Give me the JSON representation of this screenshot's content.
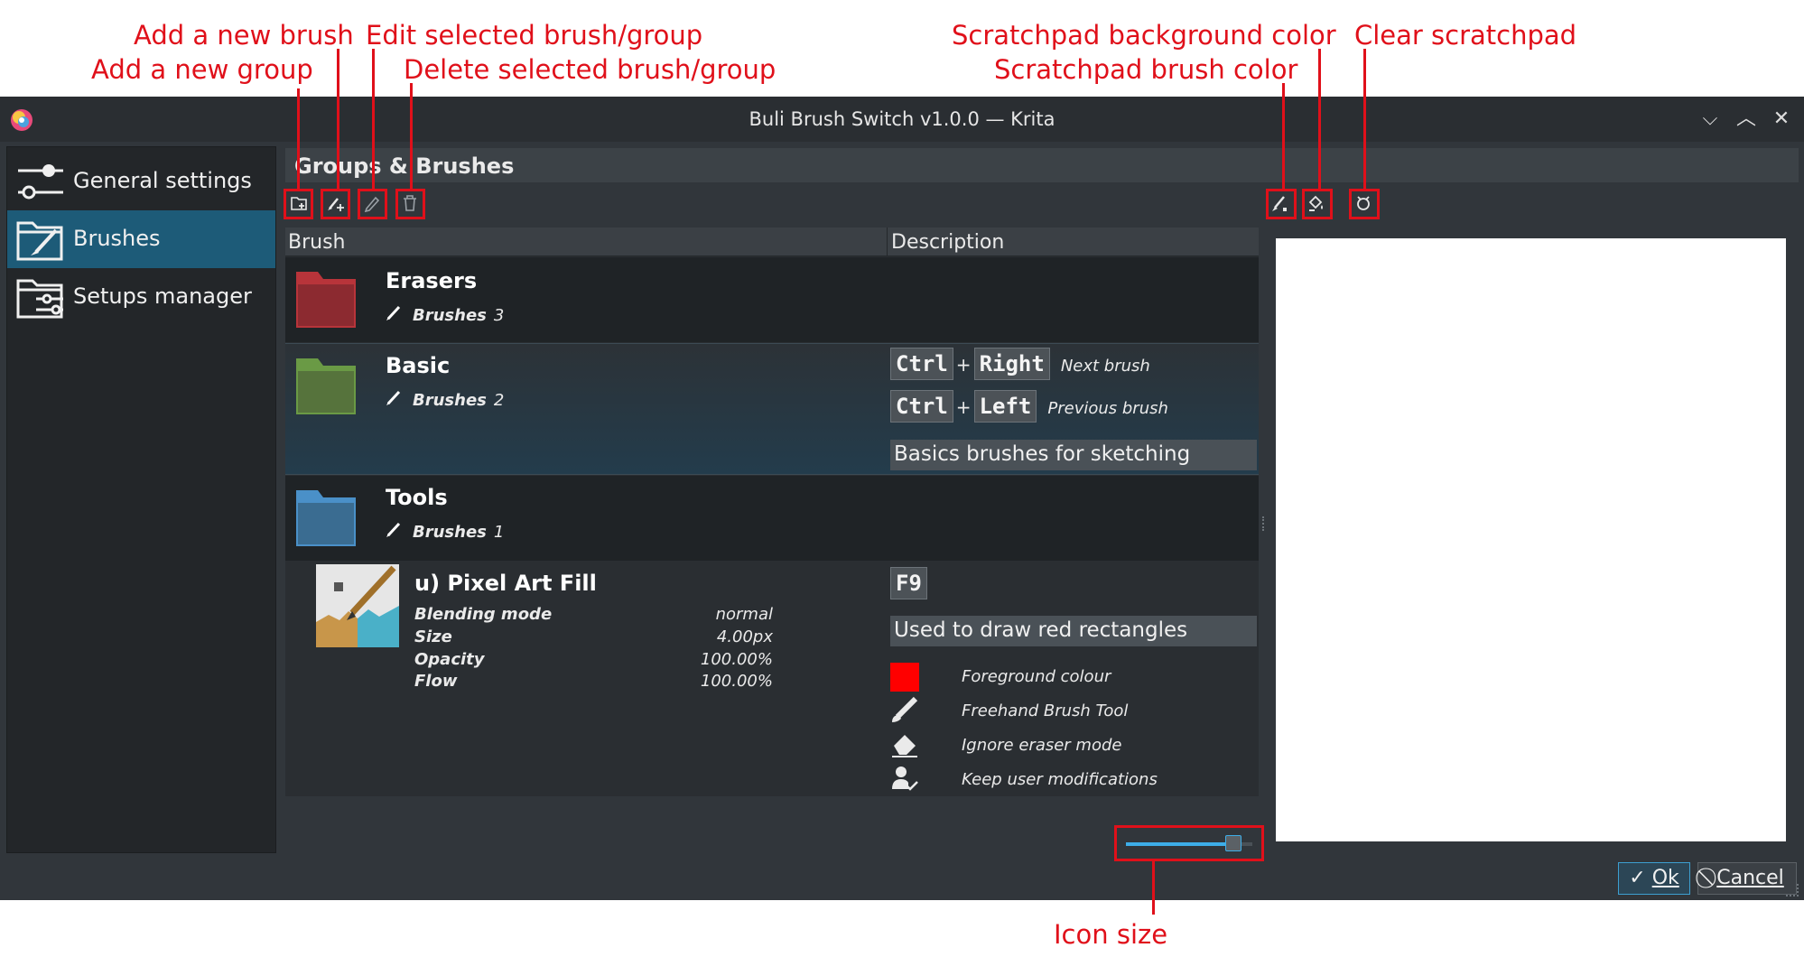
{
  "annotations": {
    "add_group": "Add a new group",
    "add_brush": "Add a new brush",
    "edit_selected": "Edit selected brush/group",
    "delete_selected": "Delete selected brush/group",
    "scratch_bg": "Scratchpad background color",
    "scratch_brush": "Scratchpad brush color",
    "clear_scratch": "Clear scratchpad",
    "icon_size": "Icon size"
  },
  "window": {
    "title": "Buli Brush Switch v1.0.0 — Krita",
    "minimize_glyph": "⌵",
    "maximize_glyph": "︿",
    "close_glyph": "✕"
  },
  "sidebar": {
    "items": [
      {
        "label": "General settings",
        "icon": "sliders-icon",
        "active": false
      },
      {
        "label": "Brushes",
        "icon": "folder-brush-icon",
        "active": true
      },
      {
        "label": "Setups manager",
        "icon": "folder-settings-icon",
        "active": false
      }
    ]
  },
  "panel": {
    "header": "Groups & Brushes",
    "columns": {
      "brush": "Brush",
      "description": "Description"
    }
  },
  "groups": [
    {
      "name": "Erasers",
      "count_label": "Brushes",
      "count": "3",
      "color": "#b8343a"
    },
    {
      "name": "Basic",
      "count_label": "Brushes",
      "count": "2",
      "color": "#6a9a45",
      "shortcuts": [
        {
          "k1": "Ctrl",
          "sep": "+",
          "k2": "Right",
          "desc": "Next brush"
        },
        {
          "k1": "Ctrl",
          "sep": "+",
          "k2": "Left",
          "desc": "Previous brush"
        }
      ],
      "description": "Basics brushes for sketching"
    },
    {
      "name": "Tools",
      "count_label": "Brushes",
      "count": "1",
      "color": "#4a90c8"
    }
  ],
  "brush": {
    "name": "u) Pixel Art Fill",
    "props": [
      {
        "label": "Blending mode",
        "value": "normal"
      },
      {
        "label": "Size",
        "value": "4.00px"
      },
      {
        "label": "Opacity",
        "value": "100.00%"
      },
      {
        "label": "Flow",
        "value": "100.00%"
      }
    ],
    "shortcut": "F9",
    "description": "Used to draw red rectangles",
    "options": [
      {
        "icon": "color-swatch-icon",
        "text": "Foreground colour",
        "color": "#ff0000"
      },
      {
        "icon": "brush-tool-icon",
        "text": "Freehand Brush Tool"
      },
      {
        "icon": "eraser-icon",
        "text": "Ignore eraser mode"
      },
      {
        "icon": "user-check-icon",
        "text": "Keep user modifications"
      }
    ]
  },
  "icon_size_slider": {
    "value": 0.85
  },
  "buttons": {
    "ok": "Ok",
    "cancel": "Cancel"
  },
  "colors": {
    "accent": "#3daee9",
    "annotation": "#e0101a",
    "selected": "#1d5b78"
  }
}
